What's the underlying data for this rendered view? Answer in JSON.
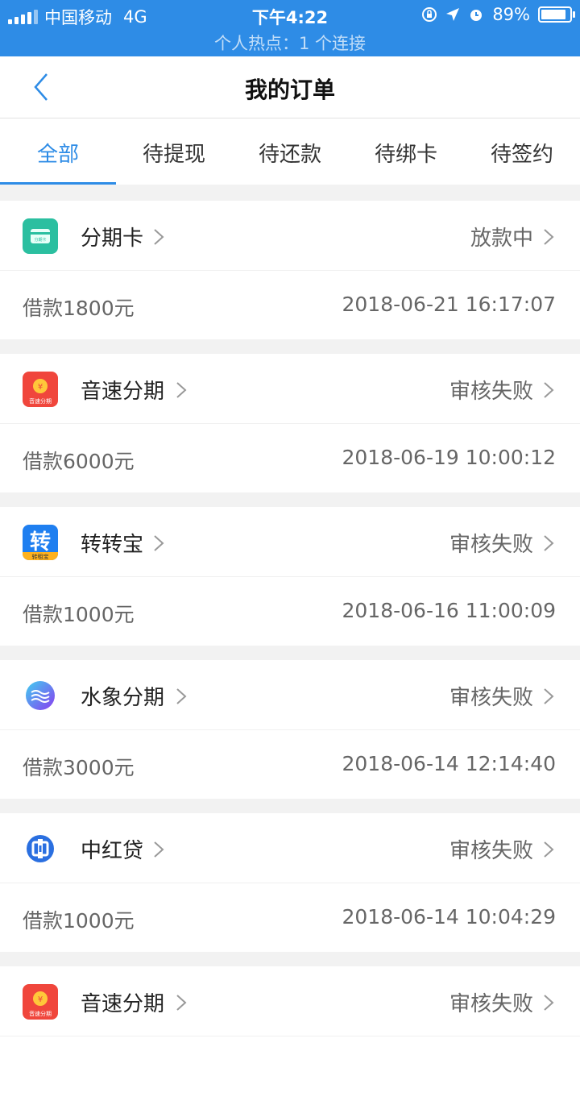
{
  "status_bar": {
    "carrier": "中国移动",
    "network": "4G",
    "time": "下午4:22",
    "battery": "89%",
    "battery_level": 0.89,
    "hotspot": "个人热点：1 个连接"
  },
  "nav": {
    "title": "我的订单"
  },
  "tabs": [
    "全部",
    "待提现",
    "待还款",
    "待绑卡",
    "待签约"
  ],
  "active_tab": "全部",
  "orders": [
    {
      "name": "分期卡",
      "status": "放款中",
      "amount": "借款1800元",
      "date": "2018-06-21 16:17:07",
      "logo": "fenqika-logo-icon"
    },
    {
      "name": "音速分期",
      "status": "审核失败",
      "amount": "借款6000元",
      "date": "2018-06-19 10:00:12",
      "logo": "yinsu-logo-icon"
    },
    {
      "name": "转转宝",
      "status": "审核失败",
      "amount": "借款1000元",
      "date": "2018-06-16 11:00:09",
      "logo": "zhuanzhuanbao-logo-icon"
    },
    {
      "name": "水象分期",
      "status": "审核失败",
      "amount": "借款3000元",
      "date": "2018-06-14 12:14:40",
      "logo": "shuixiang-logo-icon"
    },
    {
      "name": "中红贷",
      "status": "审核失败",
      "amount": "借款1000元",
      "date": "2018-06-14 10:04:29",
      "logo": "zhonghongdai-logo-icon"
    },
    {
      "name": "音速分期",
      "status": "审核失败",
      "amount": "",
      "date": "",
      "logo": "yinsu-logo-icon"
    }
  ],
  "logo_text": {
    "fenqika": "分期卡",
    "yinsu": "音速分期",
    "zhuanzhuanbao_main": "转",
    "zhuanzhuanbao_sub": "转租宝"
  },
  "colors": {
    "accent": "#2e8ce6",
    "fenqika": "#2bbfa0",
    "yinsu": "#f0463c",
    "zhuanzhuanbao": "#1f7ff0",
    "shuixiang": "#5a6cf0",
    "zhonghongdai": "#2a6fe0"
  }
}
